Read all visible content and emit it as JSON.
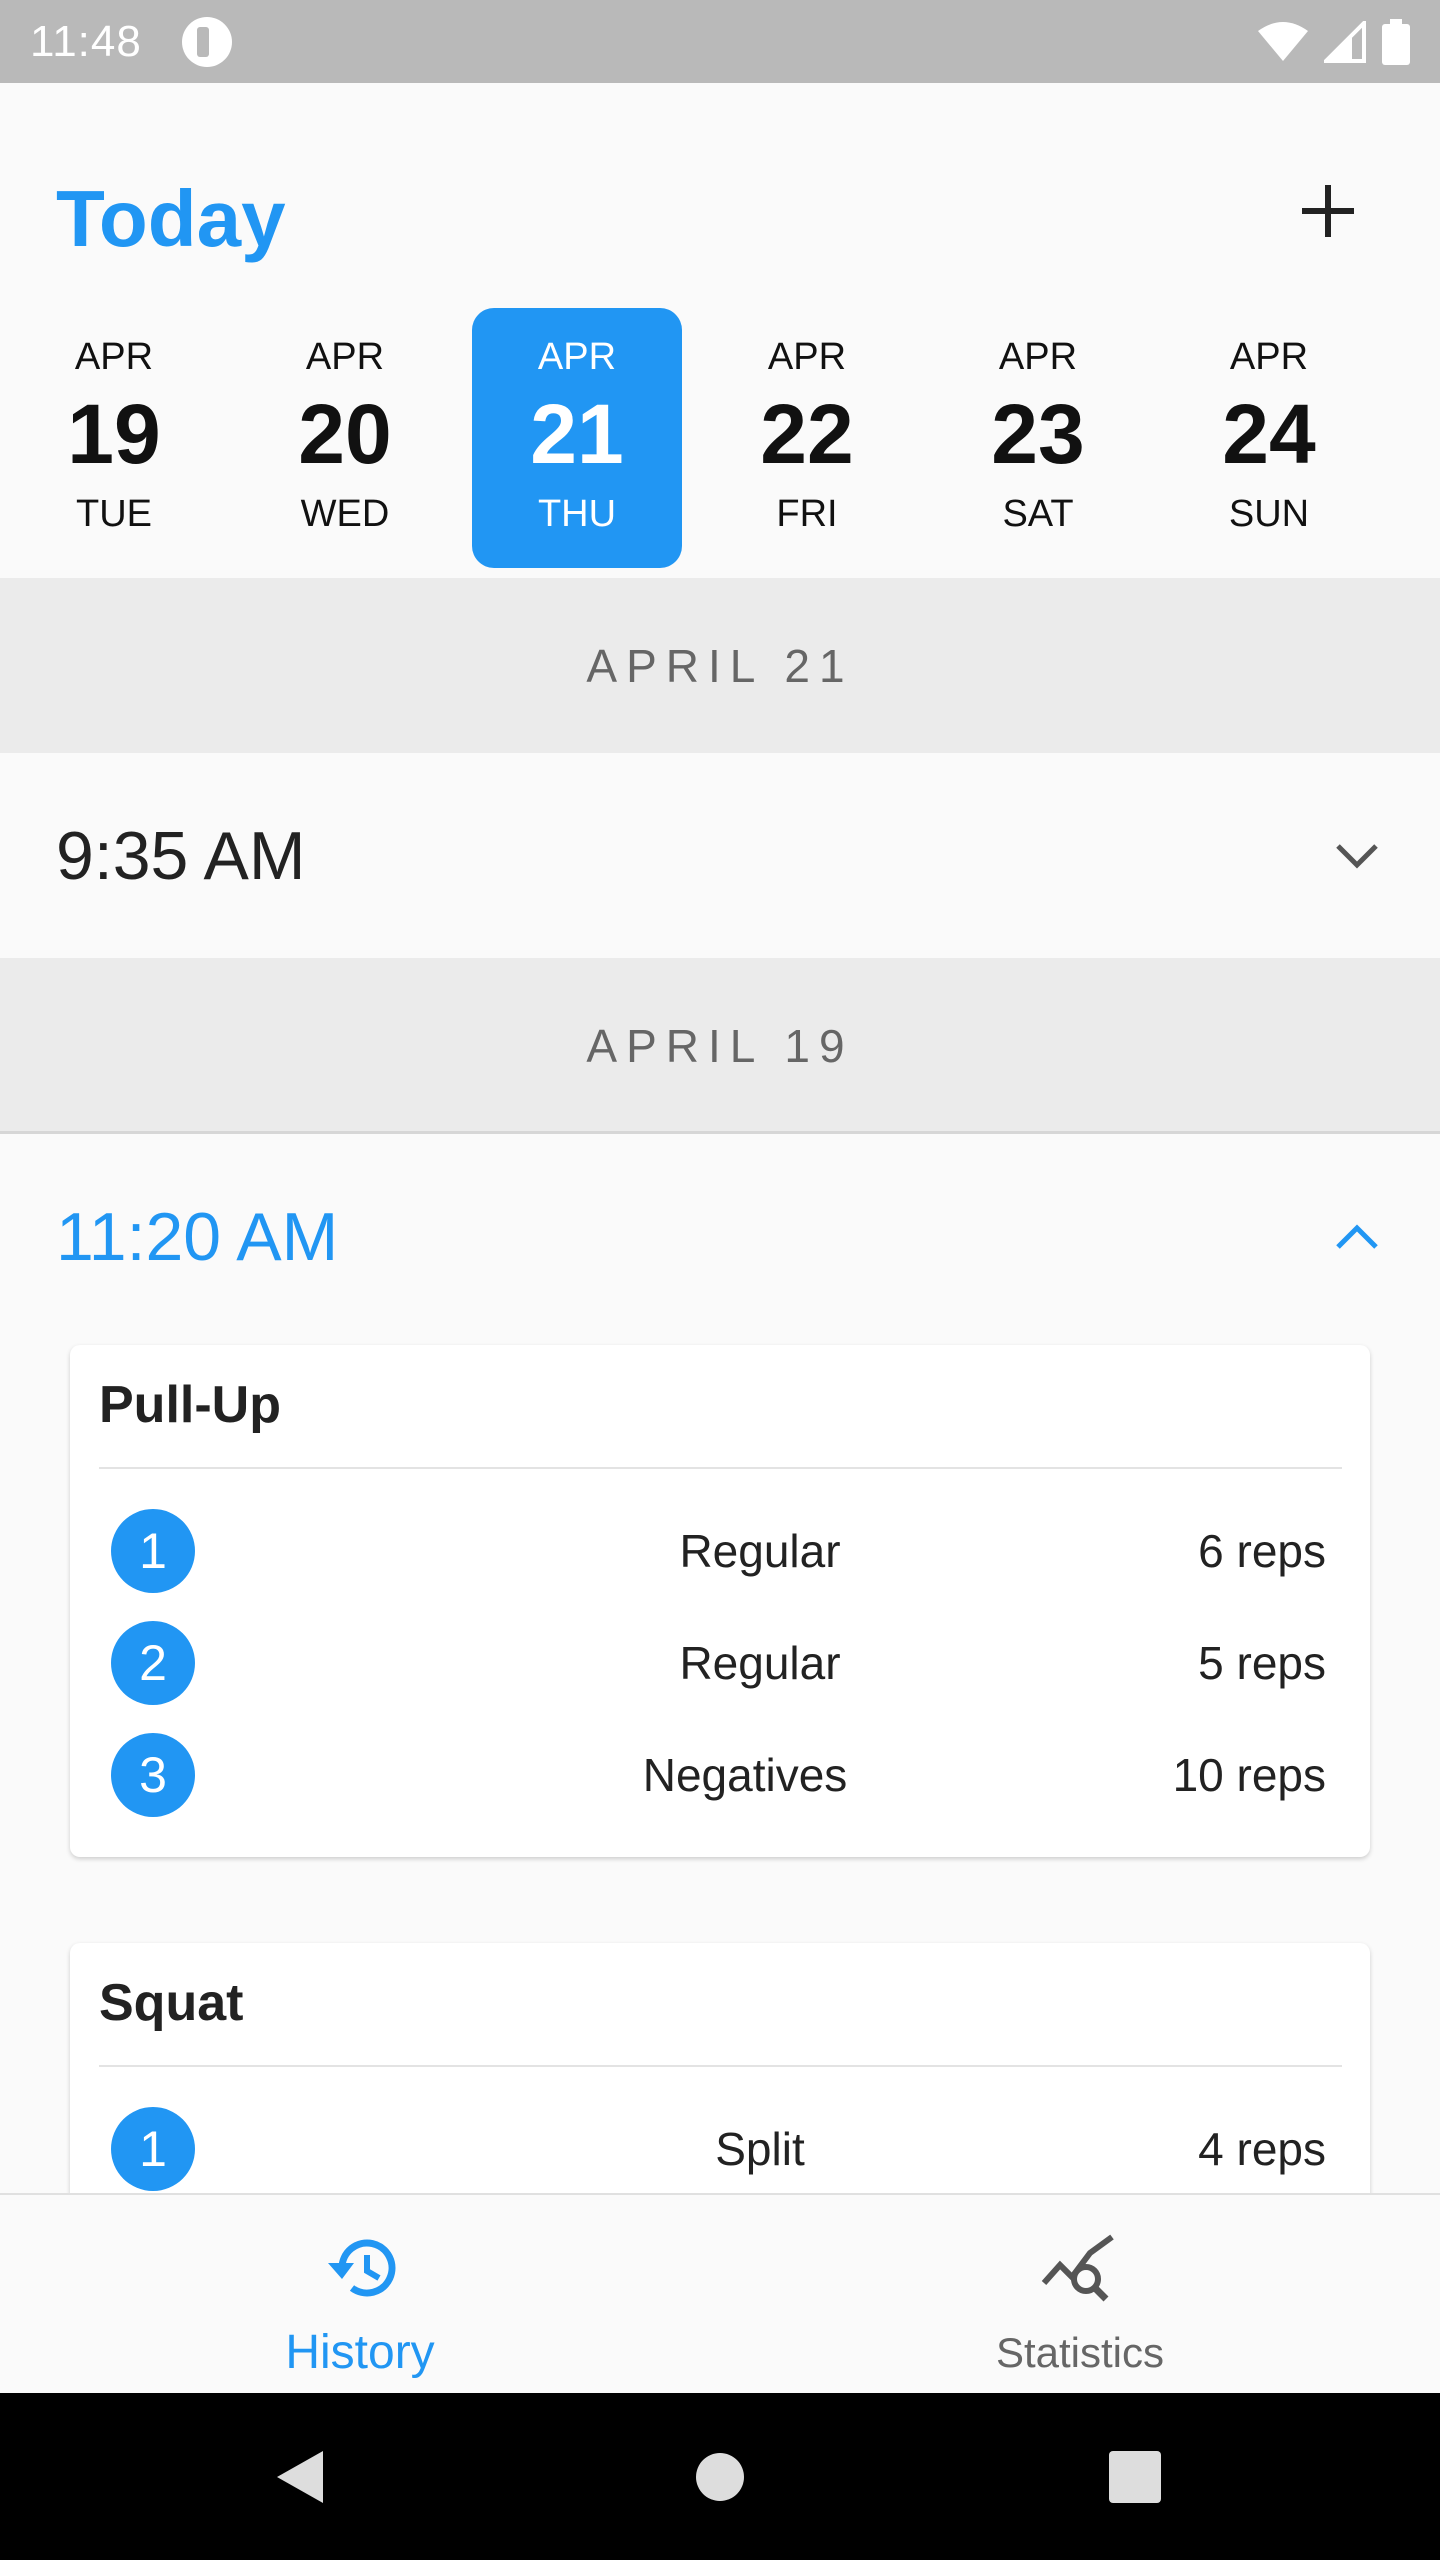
{
  "status_bar": {
    "time": "11:48",
    "icons": [
      "app-notification-icon",
      "wifi-icon",
      "signal-icon",
      "battery-icon"
    ]
  },
  "header": {
    "title": "Today",
    "add_icon": "plus-icon"
  },
  "date_strip": [
    {
      "month": "APR",
      "day": "19",
      "weekday": "TUE",
      "selected": false
    },
    {
      "month": "APR",
      "day": "20",
      "weekday": "WED",
      "selected": false
    },
    {
      "month": "APR",
      "day": "21",
      "weekday": "THU",
      "selected": true
    },
    {
      "month": "APR",
      "day": "22",
      "weekday": "FRI",
      "selected": false
    },
    {
      "month": "APR",
      "day": "23",
      "weekday": "SAT",
      "selected": false
    },
    {
      "month": "APR",
      "day": "24",
      "weekday": "SUN",
      "selected": false
    }
  ],
  "sections": [
    {
      "date_label": "APRIL 21",
      "sessions": [
        {
          "time": "9:35 AM",
          "expanded": false
        }
      ]
    },
    {
      "date_label": "APRIL 19",
      "sessions": [
        {
          "time": "11:20 AM",
          "expanded": true,
          "exercises": [
            {
              "name": "Pull-Up",
              "sets": [
                {
                  "number": "1",
                  "type": "Regular",
                  "reps": "6 reps"
                },
                {
                  "number": "2",
                  "type": "Regular",
                  "reps": "5 reps"
                },
                {
                  "number": "3",
                  "type": "Negatives",
                  "reps": "10 reps"
                }
              ]
            },
            {
              "name": "Squat",
              "sets": [
                {
                  "number": "1",
                  "type": "Split",
                  "reps": "4 reps"
                }
              ]
            }
          ]
        }
      ]
    }
  ],
  "bottom_nav": {
    "tabs": [
      {
        "label": "History",
        "icon": "history-icon",
        "active": true
      },
      {
        "label": "Statistics",
        "icon": "statistics-icon",
        "active": false
      }
    ]
  },
  "system_nav": {
    "buttons": [
      "back-icon",
      "home-icon",
      "recents-icon"
    ]
  },
  "colors": {
    "accent": "#2196f3",
    "section_bg": "#ebebeb",
    "background": "#fafafa",
    "status_bar": "#b9b9b9"
  }
}
